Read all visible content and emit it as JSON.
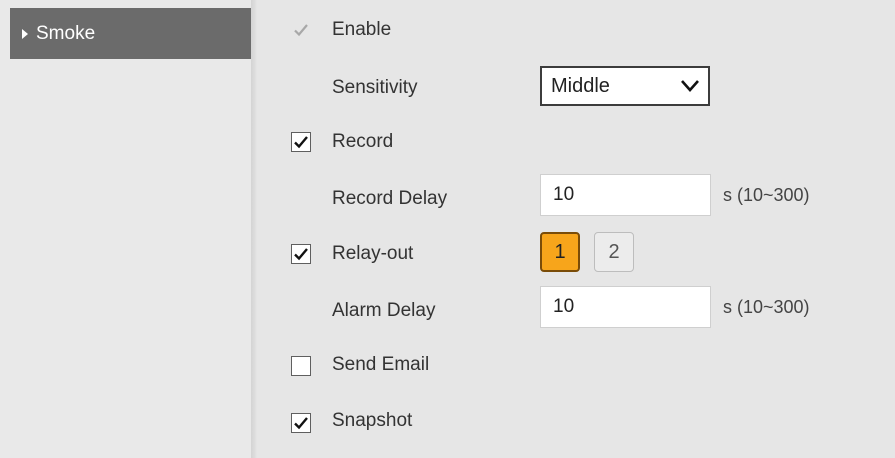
{
  "sidebar": {
    "items": [
      {
        "label": "Smoke"
      }
    ]
  },
  "form": {
    "enable": {
      "label": "Enable",
      "checked": true,
      "disabled": true
    },
    "sensitivity": {
      "label": "Sensitivity",
      "value": "Middle"
    },
    "record": {
      "label": "Record",
      "checked": true
    },
    "record_delay": {
      "label": "Record Delay",
      "value": "10",
      "unit": "s (10~300)"
    },
    "relay_out": {
      "label": "Relay-out",
      "checked": true,
      "options": [
        "1",
        "2"
      ],
      "selected": "1"
    },
    "alarm_delay": {
      "label": "Alarm Delay",
      "value": "10",
      "unit": "s (10~300)"
    },
    "send_email": {
      "label": "Send Email",
      "checked": false
    },
    "snapshot": {
      "label": "Snapshot",
      "checked": true
    }
  },
  "colors": {
    "accent": "#f7a51b",
    "nav_selected": "#6b6b6b",
    "background": "#e6e6e6"
  }
}
